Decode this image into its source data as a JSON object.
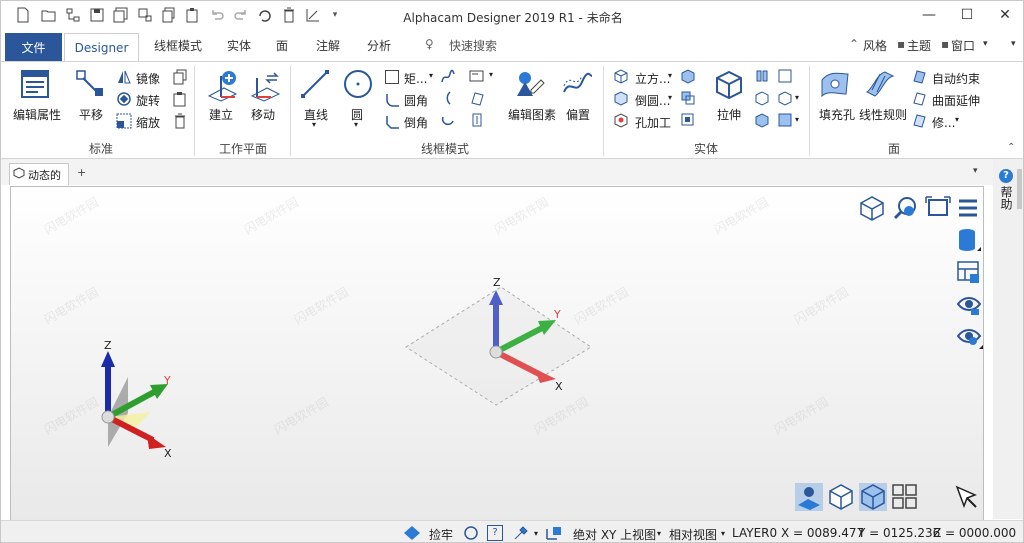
{
  "window": {
    "title": "Alphacam Designer 2019 R1 - 未命名"
  },
  "tabs": {
    "file": "文件",
    "designer": "Designer",
    "items": [
      "线框模式",
      "实体",
      "面",
      "注解",
      "分析"
    ],
    "search": "快速搜索"
  },
  "header_right": {
    "style": "风格",
    "theme": "主题",
    "window": "窗口"
  },
  "ribbon": {
    "standard": {
      "label": "标准",
      "edit_props": "编辑属性",
      "pan": "平移",
      "mirror": "镜像",
      "rotate": "旋转",
      "scale": "缩放"
    },
    "workplane": {
      "label": "工作平面",
      "create": "建立",
      "move": "移动"
    },
    "wireframe": {
      "label": "线框模式",
      "line": "直线",
      "circle": "圆",
      "rect": "矩...",
      "fillet": "圆角",
      "chamfer": "倒角"
    },
    "edit": {
      "edit_geo": "编辑图素",
      "offset": "偏置"
    },
    "solid": {
      "label": "实体",
      "cube": "立方...",
      "chamfer": "倒圆...",
      "hole": "孔加工",
      "extrude": "拉伸"
    },
    "surface": {
      "label": "面",
      "fill": "填充孔",
      "ruled": "线性规则",
      "auto_constraint": "自动约束",
      "surface_extend": "曲面延伸",
      "repair": "修..."
    }
  },
  "doc": {
    "tab": "动态的",
    "add": "+"
  },
  "right": {
    "help": "帮助"
  },
  "axes": {
    "z": "Z",
    "y": "Y",
    "x": "X"
  },
  "status": {
    "snap": "捡牢",
    "coord_mode": "绝对 XY 上视图",
    "view_mode": "相对视图",
    "layer": "LAYER0",
    "x": "X = 0089.477",
    "y": "Y = 0125.236",
    "z": "Z = 0000.000"
  },
  "watermark": "闪电软件园",
  "colors": {
    "accent": "#2b579a",
    "axis_x": "#e04040",
    "axis_y": "#3cb043",
    "axis_z": "#2b3fbf"
  }
}
